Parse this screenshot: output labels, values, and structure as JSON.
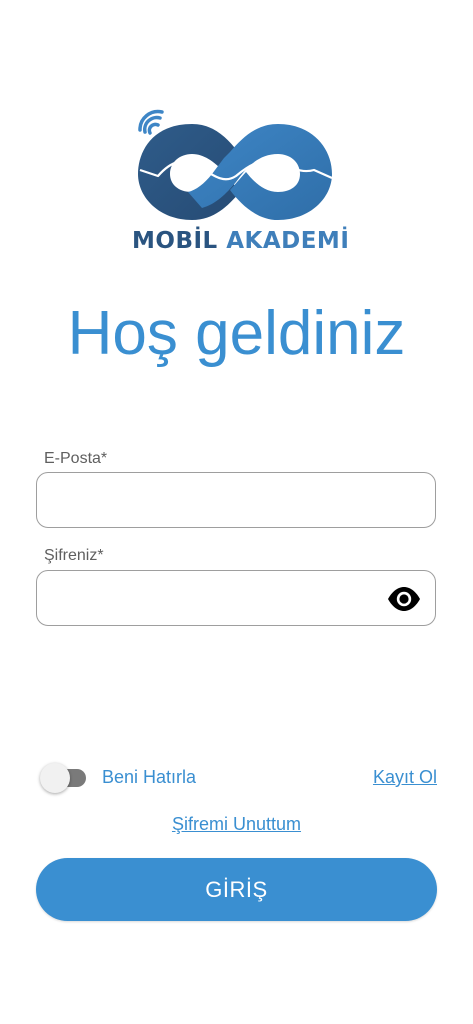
{
  "brand": {
    "part1": "MOBİL",
    "part2": "AKADEMİ",
    "colors": {
      "dark": "#2a5480",
      "light": "#3f7fba"
    }
  },
  "welcome_title": "Hoş geldiniz",
  "form": {
    "email": {
      "label": "E-Posta*",
      "value": "",
      "placeholder": ""
    },
    "password": {
      "label": "Şifreniz*",
      "value": "",
      "placeholder": "",
      "toggle_icon": "eye-icon"
    }
  },
  "remember": {
    "label": "Beni Hatırla",
    "checked": false
  },
  "register_link": "Kayıt Ol",
  "forgot_link": "Şifremi Unuttum",
  "login_button": "GİRİŞ",
  "colors": {
    "accent": "#3a8fd1",
    "background": "#ffffff"
  }
}
